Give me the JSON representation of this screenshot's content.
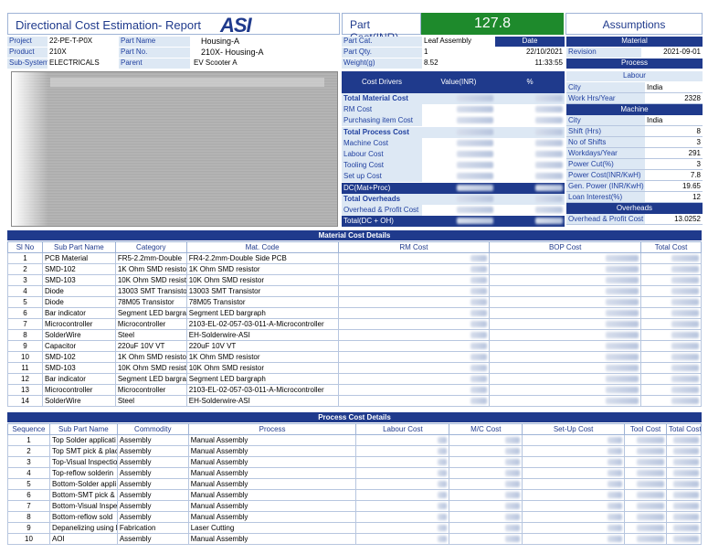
{
  "header": {
    "title": "Directional Cost Estimation- Report",
    "logo": "ASI",
    "part_cost_label": "Part Cost(INR)",
    "part_cost_value": "127.8",
    "assumptions_label": "Assumptions"
  },
  "info": {
    "project_label": "Project",
    "project_value": "22-PE-T-P0X",
    "product_label": "Product",
    "product_value": "210X",
    "subsystem_label": "Sub-System",
    "subsystem_value": "ELECTRICALS",
    "partname_label": "Part Name",
    "partname_value": "Housing-A",
    "partno_label": "Part No.",
    "partno_value": "210X- Housing-A",
    "parent_label": "Parent",
    "parent_value": "EV Scooter A",
    "partcat_label": "Part Cat.",
    "partcat_value": "Leaf Assembly",
    "partqty_label": "Part Qty.",
    "partqty_value": "1",
    "weight_label": "Weight(g)",
    "weight_value": "8.52",
    "date_label": "Date",
    "date_value": "22/10/2021",
    "time_value": "11:33:55"
  },
  "drivers": {
    "h_drivers": "Cost Drivers",
    "h_value": "Value(INR)",
    "h_pct": "%",
    "rows": [
      {
        "label": "Total Material Cost",
        "bold": true
      },
      {
        "label": "RM Cost",
        "bold": false
      },
      {
        "label": "Purchasing item Cost",
        "bold": false
      },
      {
        "label": "Total Process Cost",
        "bold": true
      },
      {
        "label": "Machine Cost",
        "bold": false
      },
      {
        "label": "Labour Cost",
        "bold": false
      },
      {
        "label": "Tooling Cost",
        "bold": false
      },
      {
        "label": "Set up Cost",
        "bold": false
      },
      {
        "label": "DC(Mat+Proc)",
        "bold": false,
        "navy": true
      },
      {
        "label": "Total Overheads",
        "bold": true
      },
      {
        "label": "Overhead & Profit Cost",
        "bold": false
      },
      {
        "label": "Total(DC + OH)",
        "bold": false,
        "navy": true
      }
    ]
  },
  "assumptions": {
    "material_h": "Material",
    "revision_label": "Revision",
    "revision_value": "2021-09-01",
    "process_h": "Process",
    "labour_h": "Labour",
    "city_label": "City",
    "city_value": "India",
    "workhrs_label": "Work Hrs/Year",
    "workhrs_value": "2328",
    "machine_h": "Machine",
    "mcity_label": "City",
    "mcity_value": "India",
    "shift_label": "Shift (Hrs)",
    "shift_value": "8",
    "shifts_label": "No of Shifts",
    "shifts_value": "3",
    "workdays_label": "Workdays/Year",
    "workdays_value": "291",
    "powercut_label": "Power Cut(%)",
    "powercut_value": "3",
    "powercost_label": "Power Cost(INR/KwH)",
    "powercost_value": "7.8",
    "genpower_label": "Gen. Power (INR/KwH)",
    "genpower_value": "19.65",
    "loan_label": "Loan Interest(%)",
    "loan_value": "12",
    "overheads_h": "Overheads",
    "ohp_label": "Overhead & Profit Cost",
    "ohp_value": "13.0252"
  },
  "material": {
    "section_title": "Material Cost Details",
    "headers": [
      "Sl No",
      "Sub Part Name",
      "Category",
      "Mat. Code",
      "RM Cost",
      "BOP Cost",
      "Total Cost"
    ],
    "rows": [
      [
        "1",
        "PCB Material",
        "FR5-2.2mm-Double",
        "FR4-2.2mm-Double Side PCB"
      ],
      [
        "2",
        "SMD-102",
        "1K Ohm SMD resisto",
        "1K Ohm SMD resistor"
      ],
      [
        "3",
        "SMD-103",
        "10K Ohm SMD resist",
        "10K Ohm SMD resistor"
      ],
      [
        "4",
        "Diode",
        "13003 SMT Transisto",
        "13003 SMT Transistor"
      ],
      [
        "5",
        "Diode",
        "78M05 Transistor",
        "78M05 Transistor"
      ],
      [
        "6",
        "Bar indicator",
        "Segment LED bargra",
        "Segment LED bargraph"
      ],
      [
        "7",
        "Microcontroller",
        "Microcontroller",
        "2103-EL-02-057-03-011-A-Microcontroller"
      ],
      [
        "8",
        "SolderWire",
        "Steel",
        "EH-Solderwire-ASI"
      ],
      [
        "9",
        "Capacitor",
        "220uF 10V VT",
        "220uF 10V VT"
      ],
      [
        "10",
        "SMD-102",
        "1K Ohm SMD resisto",
        "1K Ohm SMD resistor"
      ],
      [
        "11",
        "SMD-103",
        "10K Ohm SMD resist",
        "10K Ohm SMD resistor"
      ],
      [
        "12",
        "Bar indicator",
        "Segment LED bargra",
        "Segment LED bargraph"
      ],
      [
        "13",
        "Microcontroller",
        "Microcontroller",
        "2103-EL-02-057-03-011-A-Microcontroller"
      ],
      [
        "14",
        "SolderWire",
        "Steel",
        "EH-Solderwire-ASI"
      ]
    ]
  },
  "process": {
    "section_title": "Process Cost Details",
    "headers": [
      "Sequence",
      "Sub Part Name",
      "Commodity",
      "Process",
      "Labour Cost",
      "M/C Cost",
      "Set-Up Cost",
      "Tool Cost",
      "Total Cost"
    ],
    "rows": [
      [
        "1",
        "Top Solder applicati",
        "Assembly",
        "Manual Assembly"
      ],
      [
        "2",
        "Top SMT pick & plac",
        "Assembly",
        "Manual Assembly"
      ],
      [
        "3",
        "Top-Visual Inspectio",
        "Assembly",
        "Manual Assembly"
      ],
      [
        "4",
        "Top-reflow solderin",
        "Assembly",
        "Manual Assembly"
      ],
      [
        "5",
        "Bottom-Solder appli",
        "Assembly",
        "Manual Assembly"
      ],
      [
        "6",
        "Bottom-SMT pick & ",
        "Assembly",
        "Manual Assembly"
      ],
      [
        "7",
        "Bottom-Visual Inspe",
        "Assembly",
        "Manual Assembly"
      ],
      [
        "8",
        "Bottom-reflow sold",
        "Assembly",
        "Manual Assembly"
      ],
      [
        "9",
        "Depanelizing using l",
        "Fabrication",
        "Laser Cutting"
      ],
      [
        "10",
        "AOI",
        "Assembly",
        "Manual Assembly"
      ]
    ]
  },
  "colors": {
    "navy": "#1f3a8c",
    "green": "#1e8a2c",
    "label_bg": "#dde8f4"
  }
}
